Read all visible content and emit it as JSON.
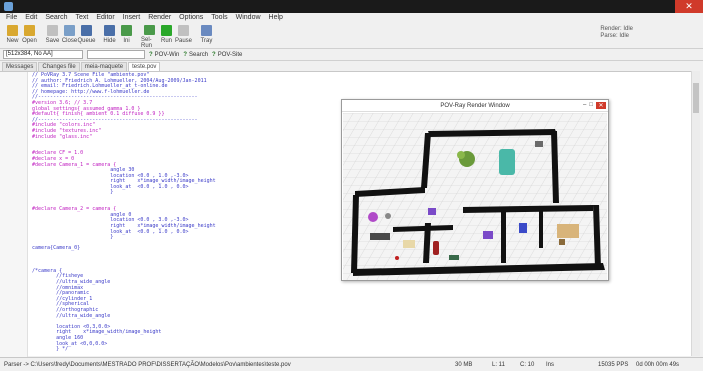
{
  "window": {
    "close_label": "✕"
  },
  "menu": [
    "File",
    "Edit",
    "Search",
    "Text",
    "Editor",
    "Insert",
    "Render",
    "Options",
    "Tools",
    "Window",
    "Help"
  ],
  "toolbar": [
    {
      "label": "New",
      "icon": "new-file-icon",
      "color": "#d9a830"
    },
    {
      "label": "Open",
      "icon": "open-folder-icon",
      "color": "#d9a830"
    },
    {
      "label": "Save",
      "icon": "save-icon",
      "color": "#c0c0c0"
    },
    {
      "label": "Close",
      "icon": "close-file-icon",
      "color": "#7a9fc8"
    },
    {
      "label": "Queue",
      "icon": "queue-icon",
      "color": "#4a6fa8"
    },
    {
      "label": "Hide",
      "icon": "hide-icon",
      "color": "#4a6fa8"
    },
    {
      "label": "Ini",
      "icon": "ini-icon",
      "color": "#4a9a4a"
    },
    {
      "label": "Sel-Run",
      "icon": "sel-run-icon",
      "color": "#4a9a4a"
    },
    {
      "label": "Run",
      "icon": "run-icon",
      "color": "#2aa82a"
    },
    {
      "label": "Pause",
      "icon": "pause-icon",
      "color": "#c0c0c0"
    },
    {
      "label": "Tray",
      "icon": "tray-icon",
      "color": "#6a8ac0"
    }
  ],
  "status_right": [
    "Render: Idle",
    "Parse: Idle"
  ],
  "secondary": {
    "resolution": "[512x384, No AA]",
    "povwin_label": "POV-Win",
    "search_label": "Search",
    "povsite_label": "POV-Site"
  },
  "tabs": [
    {
      "label": "Messages",
      "active": false
    },
    {
      "label": "Changes file",
      "active": false
    },
    {
      "label": "meia-maquete",
      "active": false
    },
    {
      "label": "teste.pov",
      "active": true
    }
  ],
  "code_lines": [
    {
      "text": "// PoVRay 3.7 Scene File \"ambiente.pov\"",
      "color": "#3a3ac8"
    },
    {
      "text": "// author: Friedrich A. Lohmueller, 2004/Aug-2009/Jan-2011",
      "color": "#3a3ac8"
    },
    {
      "text": "// email: Friedrich.Lohmueller_at_t-online.de",
      "color": "#3a3ac8"
    },
    {
      "text": "// homepage: http://www.f-lohmueller.de",
      "color": "#3a3ac8"
    },
    {
      "text": "//-----------------------------------------------------",
      "color": "#3a3ac8"
    },
    {
      "text": "#version 3.6; // 3.7",
      "color": "#c020c0"
    },
    {
      "text": "global_settings{ assumed_gamma 1.0 }",
      "color": "#c020c0"
    },
    {
      "text": "#default{ finish{ ambient 0.1 diffuse 0.9 }}",
      "color": "#c020c0"
    },
    {
      "text": "//-----------------------------------------------------",
      "color": "#3a3ac8"
    },
    {
      "text": "#include \"colors.inc\"",
      "color": "#c020c0"
    },
    {
      "text": "#include \"textures.inc\"",
      "color": "#c020c0"
    },
    {
      "text": "#include \"glass.inc\"",
      "color": "#c020c0"
    },
    {
      "text": "",
      "color": "#222"
    },
    {
      "text": "",
      "color": "#222"
    },
    {
      "text": "#declare CF = 1.0",
      "color": "#c020c0"
    },
    {
      "text": "#declare x = 0",
      "color": "#c020c0"
    },
    {
      "text": "#declare Camera_1 = camera {",
      "color": "#c020c0"
    },
    {
      "text": "                          angle 30",
      "color": "#3a3ac8"
    },
    {
      "text": "                          location <0.0 , 1.0 ,-3.0>",
      "color": "#3a3ac8"
    },
    {
      "text": "                          right    x*image_width/image_height",
      "color": "#3a3ac8"
    },
    {
      "text": "                          look_at  <0.0 , 1.0 , 0.0>",
      "color": "#3a3ac8"
    },
    {
      "text": "                          }",
      "color": "#3a3ac8"
    },
    {
      "text": "",
      "color": "#222"
    },
    {
      "text": "",
      "color": "#222"
    },
    {
      "text": "#declare Camera_2 = camera {",
      "color": "#c020c0"
    },
    {
      "text": "                          angle 0",
      "color": "#3a3ac8"
    },
    {
      "text": "                          location <0.0 , 3.0 ,-3.0>",
      "color": "#3a3ac8"
    },
    {
      "text": "                          right    x*image_width/image_height",
      "color": "#3a3ac8"
    },
    {
      "text": "                          look_at  <0.0 , 1.0 , 0.0>",
      "color": "#3a3ac8"
    },
    {
      "text": "                          }",
      "color": "#3a3ac8"
    },
    {
      "text": "",
      "color": "#222"
    },
    {
      "text": "camera{Camera_0}",
      "color": "#3a3ac8"
    },
    {
      "text": "",
      "color": "#222"
    },
    {
      "text": "",
      "color": "#222"
    },
    {
      "text": "",
      "color": "#222"
    },
    {
      "text": "/*camera {",
      "color": "#3a3ac8"
    },
    {
      "text": "        //fisheye",
      "color": "#3a3ac8"
    },
    {
      "text": "        //ultra_wide_angle",
      "color": "#3a3ac8"
    },
    {
      "text": "        //omnimax",
      "color": "#3a3ac8"
    },
    {
      "text": "        //panoramic",
      "color": "#3a3ac8"
    },
    {
      "text": "        //cylinder 1",
      "color": "#3a3ac8"
    },
    {
      "text": "        //spherical",
      "color": "#3a3ac8"
    },
    {
      "text": "        //orthographic",
      "color": "#3a3ac8"
    },
    {
      "text": "        //ultra_wide_angle",
      "color": "#3a3ac8"
    },
    {
      "text": "",
      "color": "#222"
    },
    {
      "text": "        location <0,3,0.0>",
      "color": "#3a3ac8"
    },
    {
      "text": "        right    x*image_width/image_height",
      "color": "#3a3ac8"
    },
    {
      "text": "        angle 160",
      "color": "#3a3ac8"
    },
    {
      "text": "        look_at <0,0,0.0>",
      "color": "#3a3ac8"
    },
    {
      "text": "        } */",
      "color": "#3a3ac8"
    }
  ],
  "render_window": {
    "title": "POV-Ray Render Window",
    "controls": [
      "–",
      "□",
      "✕"
    ]
  },
  "statusbar": {
    "path": "Parser -> C:\\Users\\fredy\\Documents\\MESTRADO PROF\\DISSERTAÇÃO\\Modelos\\Pov\\ambientes\\teste.pov",
    "memory": "30 MB",
    "line": "L: 11",
    "col": "C: 10",
    "mode": "Ins",
    "pps": "15035 PPS",
    "time": "0d 00h 00m 49s"
  }
}
